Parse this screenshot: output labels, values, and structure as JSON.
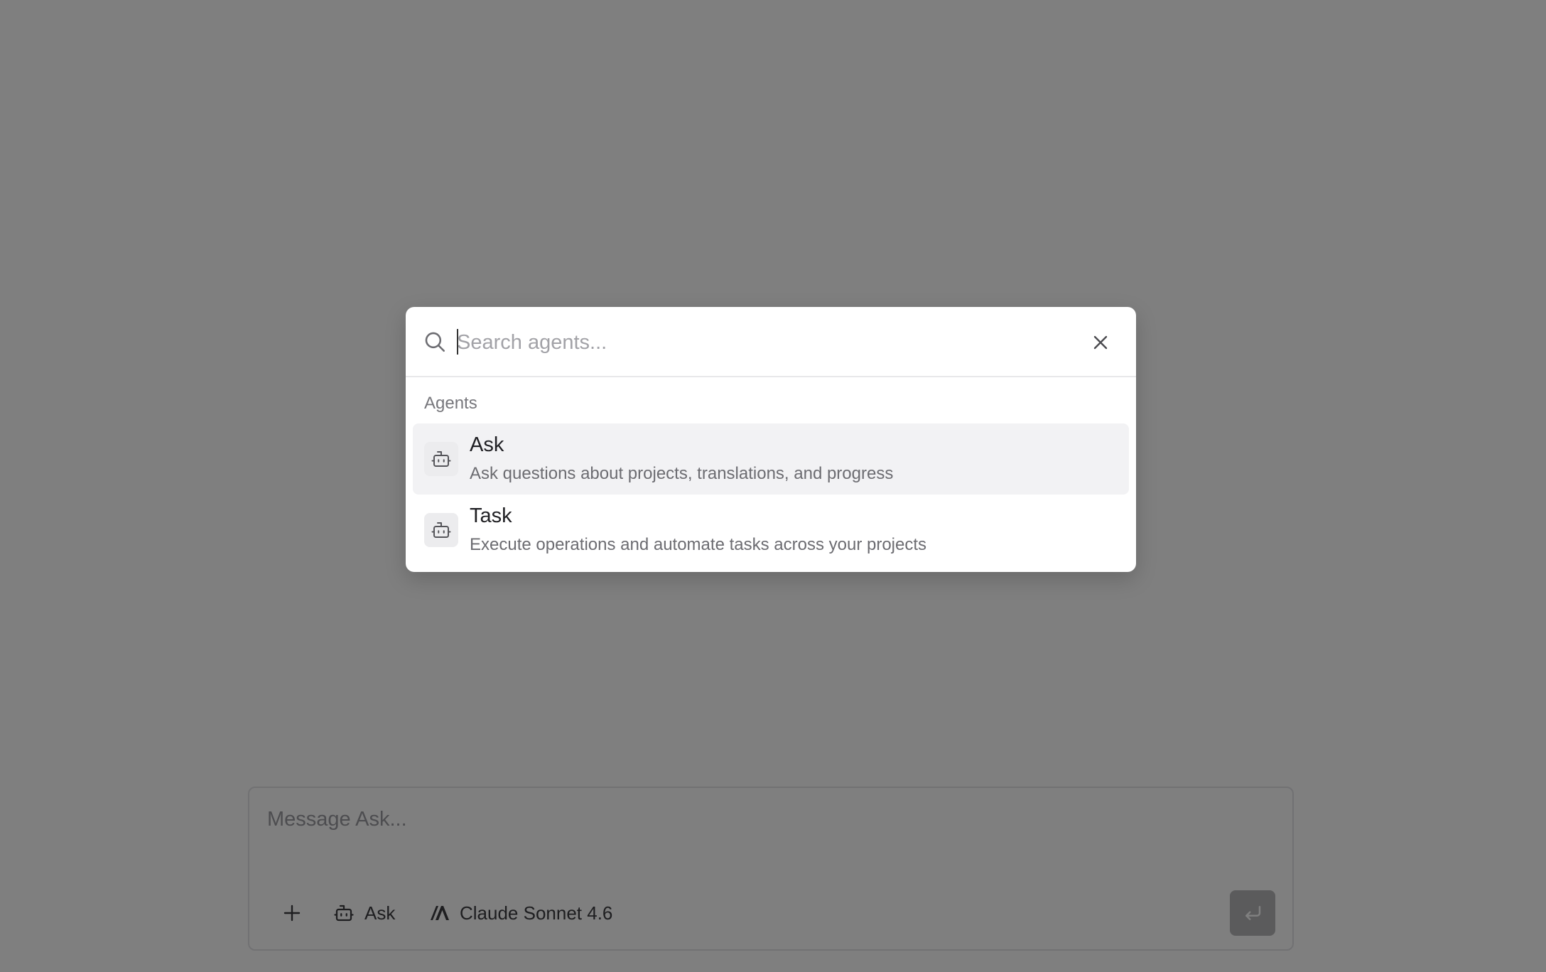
{
  "composer": {
    "placeholder": "Message Ask...",
    "agent_label": "Ask",
    "model_label": "Claude Sonnet 4.6"
  },
  "agent_picker": {
    "search_placeholder": "Search agents...",
    "section_label": "Agents",
    "agents": [
      {
        "name": "Ask",
        "description": "Ask questions about projects, translations, and progress",
        "icon": "bot-icon",
        "highlighted": true
      },
      {
        "name": "Task",
        "description": "Execute operations and automate tasks across your projects",
        "icon": "bot-icon",
        "highlighted": false
      }
    ]
  },
  "colors": {
    "overlay": "rgba(0,0,0,0.5)",
    "highlight_row": "#f2f2f4",
    "text_primary": "#1f1f23",
    "text_secondary": "#6c6c71"
  }
}
